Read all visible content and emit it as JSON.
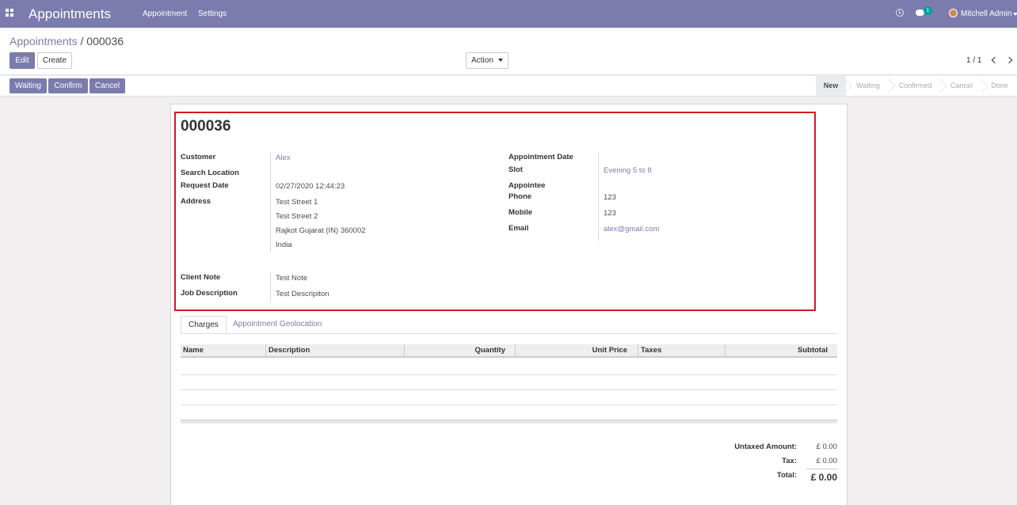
{
  "navbar": {
    "app_title": "Appointments",
    "menu": [
      "Appointment",
      "Settings"
    ],
    "messages_count": "1",
    "user_name": "Mitchell Admin"
  },
  "breadcrumb": {
    "parent": "Appointments",
    "current": "000036"
  },
  "buttons": {
    "edit": "Edit",
    "create": "Create",
    "action": "Action"
  },
  "pager": {
    "value": "1 / 1"
  },
  "status_buttons": [
    "Waiting",
    "Confirm",
    "Cancel"
  ],
  "stages": [
    "New",
    "Waiting",
    "Confirmed",
    "Cancel",
    "Done"
  ],
  "active_stage": "New",
  "record": {
    "title": "000036",
    "left": {
      "customer_label": "Customer",
      "customer": "Alex",
      "search_location_label": "Search Location",
      "request_date_label": "Request Date",
      "request_date": "02/27/2020 12:44:23",
      "address_label": "Address",
      "address": [
        "Test Street 1",
        "Test Street 2",
        "Rajkot  Gujarat (IN)  360002",
        "India"
      ],
      "client_note_label": "Client Note",
      "client_note": "Test Note",
      "job_description_label": "Job Description",
      "job_description": "Test Descripiton"
    },
    "right": {
      "appointment_date_label": "Appointment Date",
      "slot_label": "Slot",
      "slot": "Evening 5 to 8",
      "appointee_label": "Appointee",
      "phone_label": "Phone",
      "phone": "123",
      "mobile_label": "Mobile",
      "mobile": "123",
      "email_label": "Email",
      "email": "alex@gmail.com"
    }
  },
  "tabs": [
    "Charges",
    "Appointment Geolocation"
  ],
  "table": {
    "columns": [
      "Name",
      "Description",
      "Quantity",
      "Unit Price",
      "Taxes",
      "Subtotal"
    ]
  },
  "totals": {
    "untaxed_label": "Untaxed Amount:",
    "untaxed": "£ 0.00",
    "tax_label": "Tax:",
    "tax": "£ 0.00",
    "total_label": "Total:",
    "total": "£ 0.00"
  },
  "colors": {
    "brand": "#7c7bad",
    "highlight": "#d41a1f",
    "badge": "#00a09d"
  }
}
